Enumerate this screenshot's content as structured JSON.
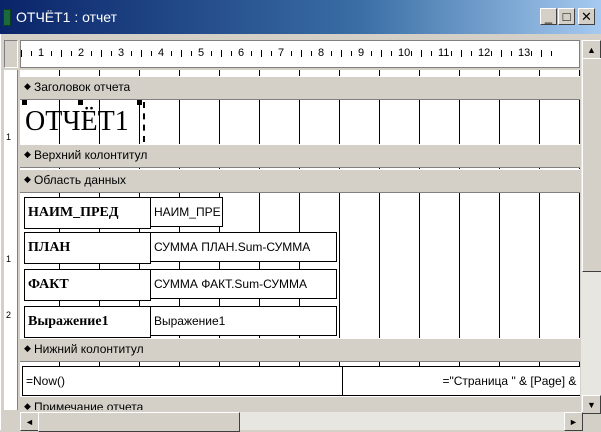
{
  "window": {
    "title": "ОТЧЁТ1 : отчет",
    "minimize_glyph": "_",
    "maximize_glyph": "□",
    "close_glyph": "✕",
    "arrow_glyph": "◆"
  },
  "ruler": {
    "numbers": [
      "1",
      "2",
      "3",
      "4",
      "5",
      "6",
      "7",
      "8",
      "9",
      "10",
      "11",
      "12",
      "13"
    ]
  },
  "vruler": {
    "marks": [
      "1",
      "1",
      "2"
    ]
  },
  "sections": {
    "report_header": "Заголовок отчета",
    "page_header": "Верхний колонтитул",
    "detail": "Область данных",
    "page_footer": "Нижний колонтитул",
    "report_footer": "Примечание отчета"
  },
  "report_title": "ОТЧЁТ1",
  "detail_rows": [
    {
      "label": "НАИМ_ПРЕД",
      "value": "НАИМ_ПРЕ"
    },
    {
      "label": "ПЛАН",
      "value": "СУММА ПЛАН.Sum-СУММА"
    },
    {
      "label": "ФАКТ",
      "value": "СУММА ФАКТ.Sum-СУММА"
    },
    {
      "label": "Выражение1",
      "value": "Выражение1"
    }
  ],
  "footer": {
    "now_expr": "=Now()",
    "page_expr": "=\"Страница \" & [Page] & \""
  },
  "scroll": {
    "up": "▲",
    "down": "▼",
    "left": "◄",
    "right": "►"
  }
}
